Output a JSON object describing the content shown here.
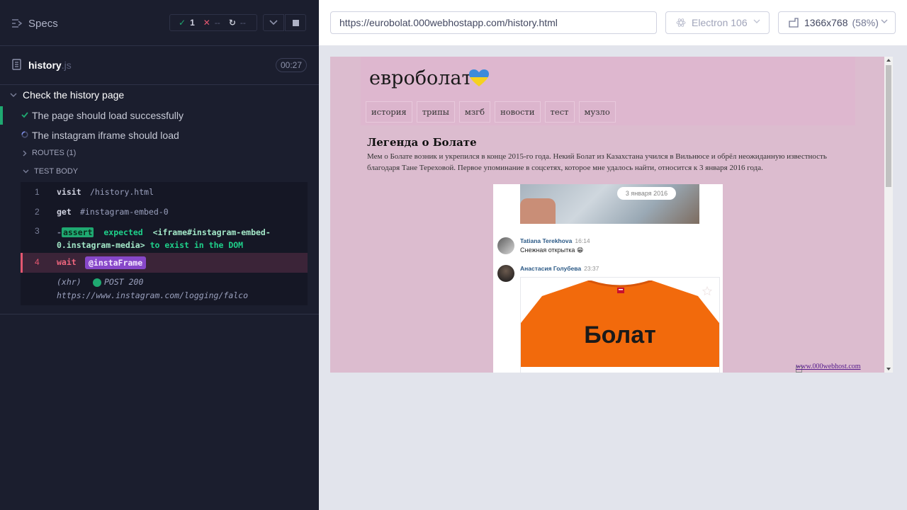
{
  "reporter": {
    "specs_label": "Specs",
    "stats": {
      "passed": "1",
      "failed": "--",
      "pending": "--"
    },
    "file": {
      "name": "history",
      "ext": ".js",
      "duration": "00:27"
    },
    "suite_title": "Check the history page",
    "tests": [
      {
        "title": "The page should load successfully",
        "state": "passed"
      },
      {
        "title": "The instagram iframe should load",
        "state": "running"
      }
    ],
    "routes_label": "ROUTES (1)",
    "test_body_label": "TEST BODY",
    "commands": [
      {
        "num": "1",
        "name": "visit",
        "message": "/history.html"
      },
      {
        "num": "2",
        "name": "get",
        "message": "#instagram-embed-0"
      },
      {
        "num": "3",
        "name": "assert",
        "prefix": "-",
        "message_start": "expected",
        "element": "<iframe#instagram-embed-0.instagram-media>",
        "message_end": "to exist in the DOM"
      },
      {
        "num": "4",
        "name": "wait",
        "alias": "@instaFrame"
      },
      {
        "xhr": "(xhr)",
        "method_status": "POST 200",
        "url": "https://www.instagram.com/logging/falco"
      }
    ]
  },
  "aut": {
    "url": "https://eurobolat.000webhostapp.com/history.html",
    "browser": "Electron 106",
    "viewport": "1366x768",
    "scale": "(58%)"
  },
  "site": {
    "title": "евроболат",
    "nav": [
      "история",
      "трипы",
      "мзгб",
      "новости",
      "тест",
      "музло"
    ],
    "article_title": "Легенда о Болате",
    "article_text": "Мем о Болате возник и укрепился в конце 2015-го года. Некий Болат из Казахстана учился в Вильнюсе и обрёл неожиданную известность благодаря Тане Тереховой. Первое упоминание в соцсетях, которое мне удалось найти, относится к 3 января 2016 года.",
    "embed": {
      "date": "3 января 2016",
      "messages": [
        {
          "author": "Tatiana Terekhova",
          "time": "16:14",
          "text": "Снежная открытка 😁"
        },
        {
          "author": "Анастасия Голубева",
          "time": "23:37",
          "text": ""
        }
      ],
      "tshirt_text": "Болат"
    },
    "host_link": "www.000webhost.com"
  },
  "colors": {
    "pass": "#1fa971",
    "fail": "#e45770",
    "alias": "#8747c9",
    "site_bg": "#dcbccf"
  }
}
